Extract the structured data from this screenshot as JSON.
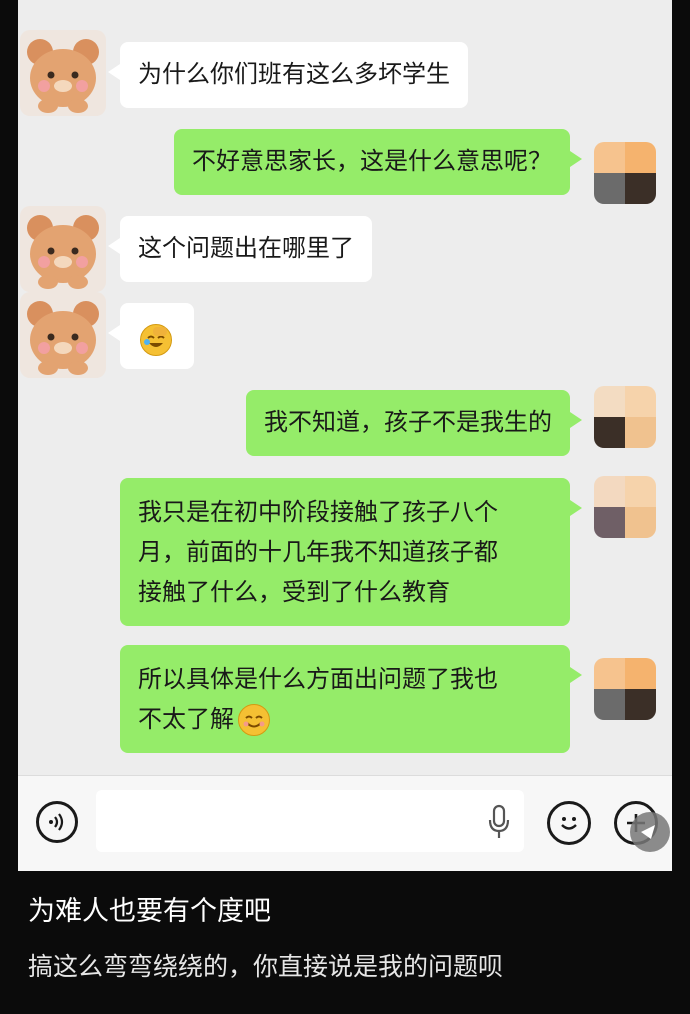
{
  "messages": [
    {
      "side": "left",
      "text": "为什么你们班有这么多坏学生"
    },
    {
      "side": "right",
      "text": "不好意思家长，这是什么意思呢？"
    },
    {
      "side": "left",
      "text": "这个问题出在哪里了"
    },
    {
      "side": "left",
      "emoji": "facepalm-laugh-emoji"
    },
    {
      "side": "right",
      "text": "我不知道，孩子不是我生的"
    },
    {
      "side": "right",
      "lines": [
        "我只是在初中阶段接触了孩子八个",
        "月，前面的十几年我不知道孩子都",
        "接触了什么，受到了什么教育"
      ]
    },
    {
      "side": "right",
      "lines": [
        "所以具体是什么方面出问题了我也",
        "不太了解"
      ],
      "trailing_emoji": "smile-emoji"
    }
  ],
  "input_bar": {
    "voice_icon": "voice-icon",
    "mic_icon": "mic-icon",
    "sticker_icon": "smiley-icon",
    "more_icon": "plus-icon"
  },
  "caption": {
    "title": "为难人也要有个度吧",
    "body": "搞这么弯弯绕绕的，你直接说是我的问题呗"
  },
  "colors": {
    "outgoing_bubble": "#95ec69",
    "incoming_bubble": "#ffffff",
    "chat_background": "#ededed",
    "page_background": "#0b0b0b"
  }
}
